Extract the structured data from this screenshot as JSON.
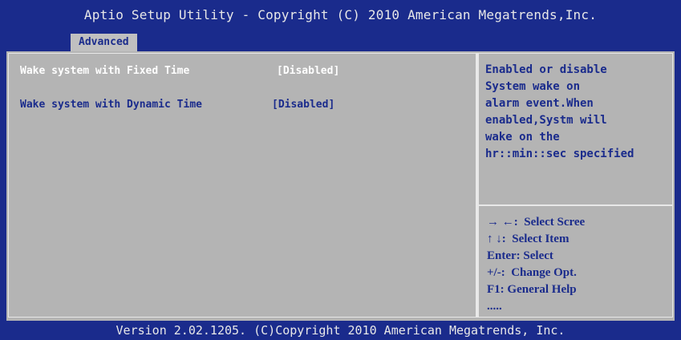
{
  "header": {
    "title": "Aptio Setup Utility - Copyright (C) 2010 American Megatrends,Inc."
  },
  "tabs": [
    {
      "label": "Advanced"
    }
  ],
  "menu": {
    "items": [
      {
        "label": "Wake system with Fixed Time",
        "value": "[Disabled]",
        "state": "selected"
      },
      {
        "label": "Wake system with Dynamic Time",
        "value": "[Disabled]",
        "state": "normal"
      }
    ]
  },
  "help": {
    "lines": [
      "Enabled or disable",
      "System wake on",
      "alarm event.When",
      "enabled,Systm will",
      "wake on the",
      "hr::min::sec specified"
    ]
  },
  "keys": [
    {
      "text": "→ ←:  Select Scree"
    },
    {
      "text": "↑ ↓:  Select Item"
    },
    {
      "text": "Enter: Select"
    },
    {
      "text": "+/-:  Change Opt."
    },
    {
      "text": "F1: General Help"
    },
    {
      "text": "....."
    }
  ],
  "footer": {
    "text": "Version 2.02.1205. (C)Copyright 2010 American Megatrends, Inc."
  },
  "colors": {
    "background": "#1a2b8c",
    "panel": "#b4b4b4",
    "highlight_text": "#ffffff",
    "text": "#1a2b8c"
  }
}
